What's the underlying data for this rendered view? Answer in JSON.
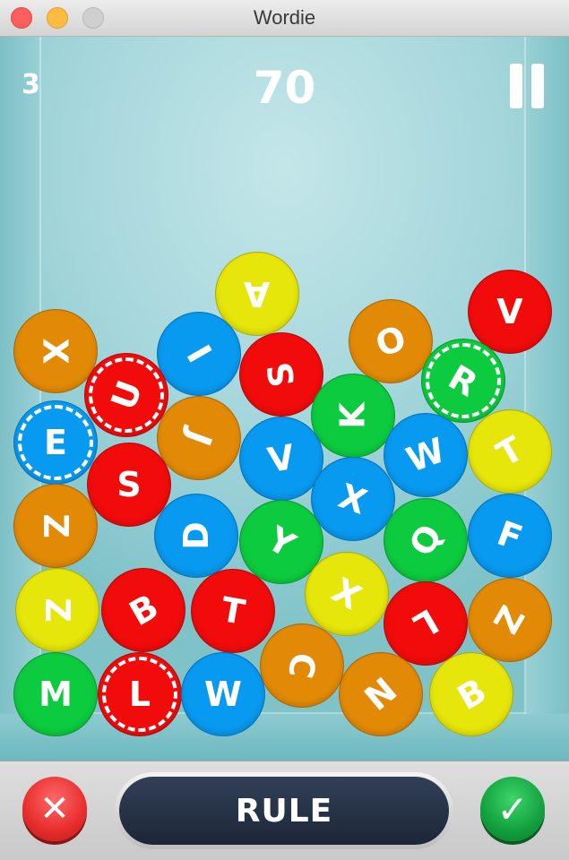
{
  "window": {
    "title": "Wordie"
  },
  "hud": {
    "level": "3",
    "score": "70",
    "pause_icon": "pause-icon"
  },
  "colors": {
    "orange": "#e28a06",
    "red": "#f10b0b",
    "blue": "#0899f0",
    "green": "#0ccb3e",
    "yellow": "#e6e60a"
  },
  "balls": [
    {
      "letter": "A",
      "color": "yellow",
      "rotation": 180
    },
    {
      "letter": "V",
      "color": "red",
      "rotation": 0
    },
    {
      "letter": "X",
      "color": "orange",
      "rotation": 90
    },
    {
      "letter": "I",
      "color": "blue",
      "rotation": 60
    },
    {
      "letter": "O",
      "color": "orange",
      "rotation": -20
    },
    {
      "letter": "U",
      "color": "red",
      "rotation": -70,
      "special": true
    },
    {
      "letter": "S",
      "color": "red",
      "rotation": -100
    },
    {
      "letter": "R",
      "color": "green",
      "rotation": 30,
      "special": true
    },
    {
      "letter": "K",
      "color": "green",
      "rotation": -90
    },
    {
      "letter": "E",
      "color": "blue",
      "rotation": 0,
      "special": true
    },
    {
      "letter": "J",
      "color": "orange",
      "rotation": 110
    },
    {
      "letter": "V",
      "color": "blue",
      "rotation": -10
    },
    {
      "letter": "W",
      "color": "blue",
      "rotation": -20
    },
    {
      "letter": "T",
      "color": "yellow",
      "rotation": -30
    },
    {
      "letter": "S",
      "color": "red",
      "rotation": 0
    },
    {
      "letter": "X",
      "color": "blue",
      "rotation": 20
    },
    {
      "letter": "Z",
      "color": "orange",
      "rotation": 90
    },
    {
      "letter": "D",
      "color": "blue",
      "rotation": -90
    },
    {
      "letter": "Y",
      "color": "green",
      "rotation": 30
    },
    {
      "letter": "Q",
      "color": "green",
      "rotation": -60
    },
    {
      "letter": "F",
      "color": "blue",
      "rotation": 20
    },
    {
      "letter": "Z",
      "color": "yellow",
      "rotation": 90
    },
    {
      "letter": "B",
      "color": "red",
      "rotation": -30
    },
    {
      "letter": "T",
      "color": "red",
      "rotation": 10
    },
    {
      "letter": "X",
      "color": "yellow",
      "rotation": 30
    },
    {
      "letter": "L",
      "color": "red",
      "rotation": 150
    },
    {
      "letter": "Z",
      "color": "orange",
      "rotation": -60
    },
    {
      "letter": "M",
      "color": "green",
      "rotation": 0
    },
    {
      "letter": "L",
      "color": "red",
      "rotation": 0,
      "special": true
    },
    {
      "letter": "W",
      "color": "blue",
      "rotation": 0
    },
    {
      "letter": "C",
      "color": "orange",
      "rotation": 100
    },
    {
      "letter": "N",
      "color": "orange",
      "rotation": -40
    },
    {
      "letter": "B",
      "color": "yellow",
      "rotation": -30
    }
  ],
  "controls": {
    "cancel_icon": "close-icon",
    "cancel_glyph": "✕",
    "word": "RULE",
    "submit_icon": "checkmark-icon",
    "submit_glyph": "✓"
  }
}
